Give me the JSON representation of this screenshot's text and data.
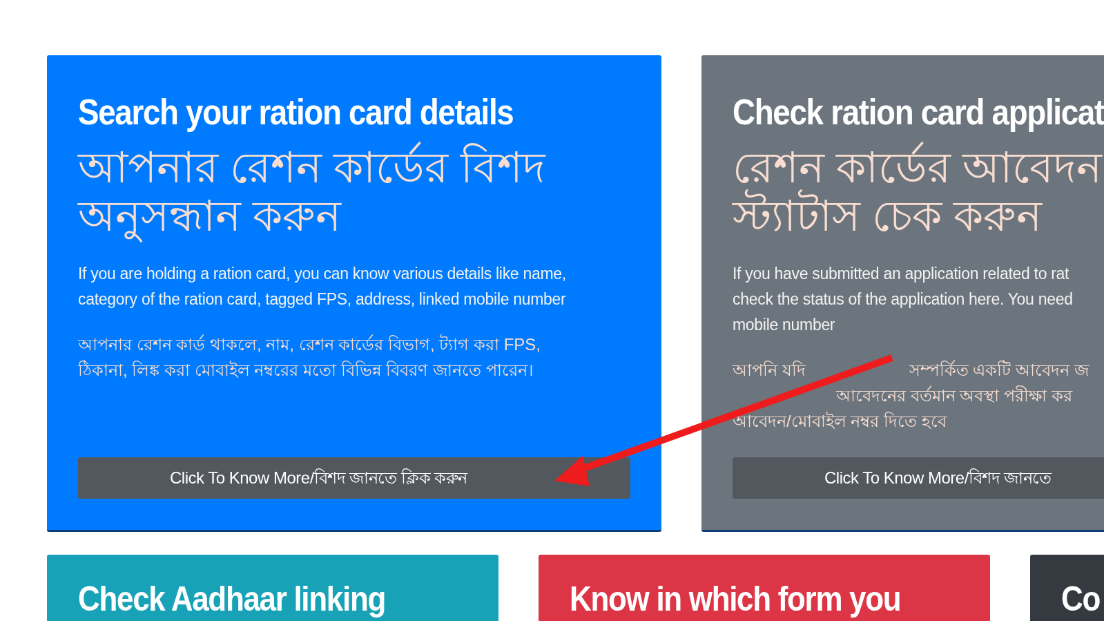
{
  "top_cards": [
    {
      "color": "#007bff",
      "title": "Search your ration card details",
      "title_bn": [
        "আপনার রেশন কার্ডের বিশদ",
        "অনুসন্ধান করুন"
      ],
      "body_en": [
        "If you are holding a ration card, you can know various details like name,",
        "category of the ration card, tagged FPS, address, linked mobile number"
      ],
      "body_bn": [
        [
          "আপনার রেশন কার্ড থাকলে, নাম, রেশন কার্ডের বিভাগ, ট্যাগ করা FPS,"
        ],
        [
          "ঠিকানা, লিঙ্ক করা মোবাইল নম্বরের মতো বিভিন্ন বিবরণ জানতে পারেন।"
        ]
      ],
      "button": "Click To Know More/বিশদ জানতে ক্লিক করুন"
    },
    {
      "color": "#6c757d",
      "title": "Check ration card applicat",
      "title_bn": [
        "রেশন কার্ডের আবেদন",
        "স্ট্যাটাস চেক করুন"
      ],
      "body_en": [
        "If you have submitted an application related to rat",
        "check the status of the application here. You need",
        "mobile number"
      ],
      "body_bn": [
        [
          "আপনি যদি",
          "সম্পর্কিত একটি আবেদন জ"
        ],
        [
          "আবেদনের বর্তমান অবস্থা পরীক্ষা কর"
        ],
        [
          "আবেদন/মোবাইল নম্বর দিতে হবে"
        ]
      ],
      "button": "Click To Know More/বিশদ জানতে"
    }
  ],
  "bottom_cards": [
    {
      "color": "#17a2b8",
      "title": "Check Aadhaar linking"
    },
    {
      "color": "#dc3545",
      "title": "Know in which form you"
    },
    {
      "color": "#343a40",
      "title": "Co"
    }
  ]
}
